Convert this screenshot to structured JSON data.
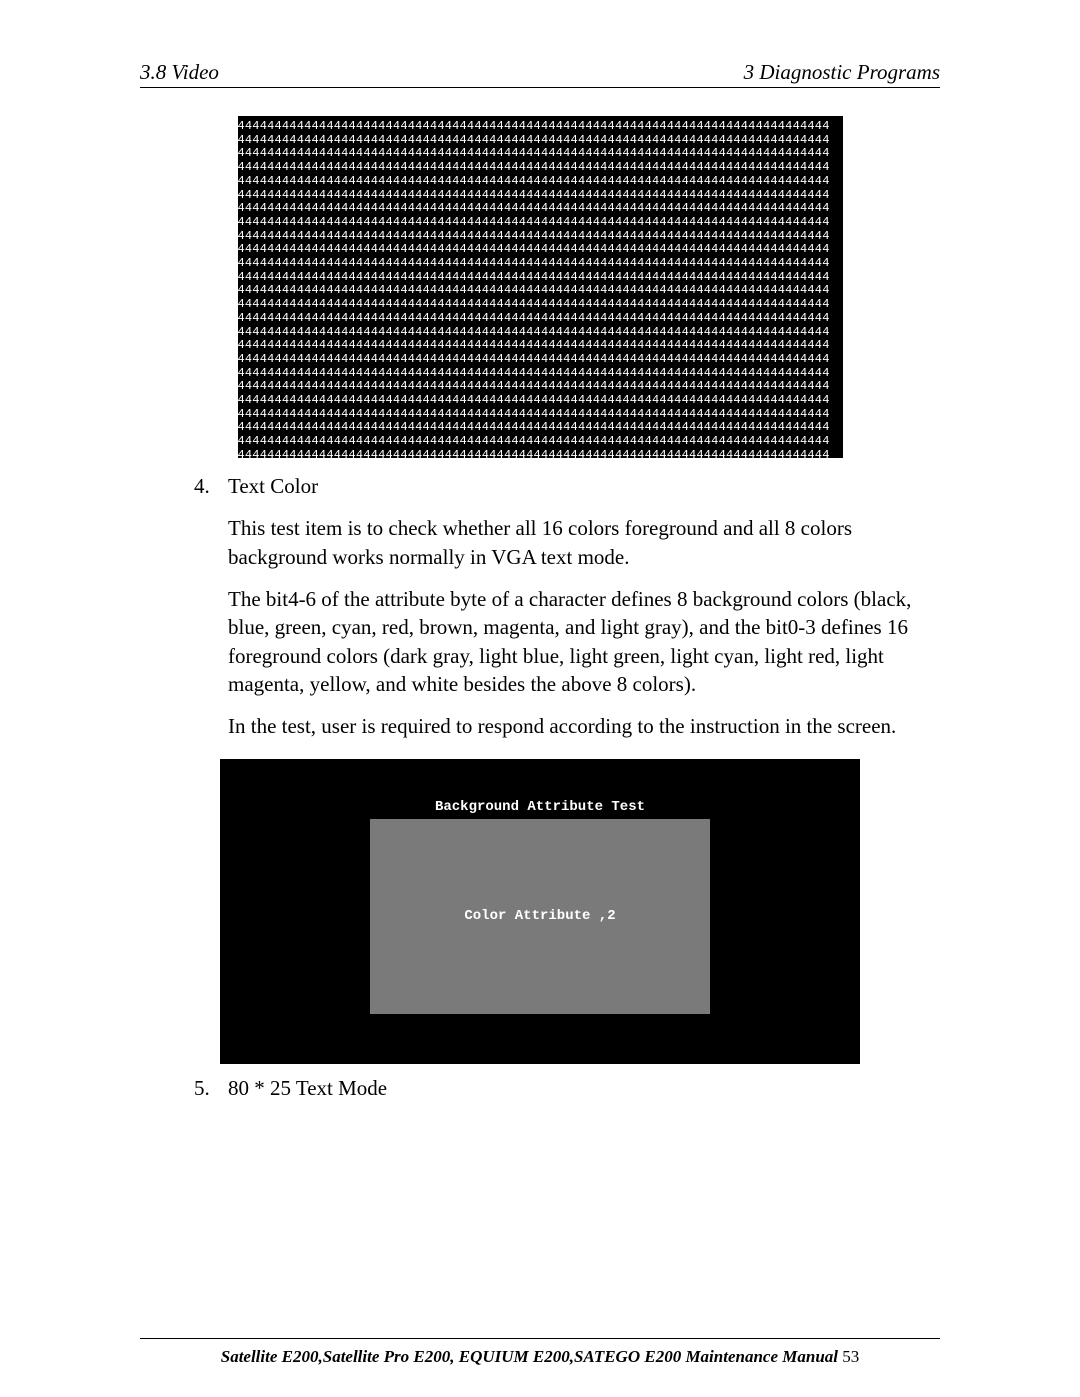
{
  "header": {
    "left": "3.8 Video",
    "right": "3  Diagnostic Programs"
  },
  "screenshot1": {
    "char": "4",
    "cols": 80,
    "rows": 25
  },
  "item4": {
    "num": "4.",
    "title": "Text Color",
    "p1": "This test item is to check whether all 16 colors foreground and all 8 colors background works normally in VGA text mode.",
    "p2": "The bit4-6 of the attribute byte of a character defines 8 background colors (black, blue, green, cyan, red, brown, magenta, and light gray), and the bit0-3 defines 16 foreground colors (dark gray, light blue, light green, light cyan, light red, light magenta, yellow, and white besides the above 8 colors).",
    "p3": "In the test, user is required to respond according to the instruction in the screen."
  },
  "screenshot2": {
    "title": "Background Attribute Test",
    "box_label": "Color Attribute ,2"
  },
  "item5": {
    "num": "5.",
    "title": "80 * 25 Text Mode"
  },
  "footer": {
    "title": "Satellite E200,Satellite Pro E200, EQUIUM E200,SATEGO E200 Maintenance Manual",
    "page": " 53"
  }
}
